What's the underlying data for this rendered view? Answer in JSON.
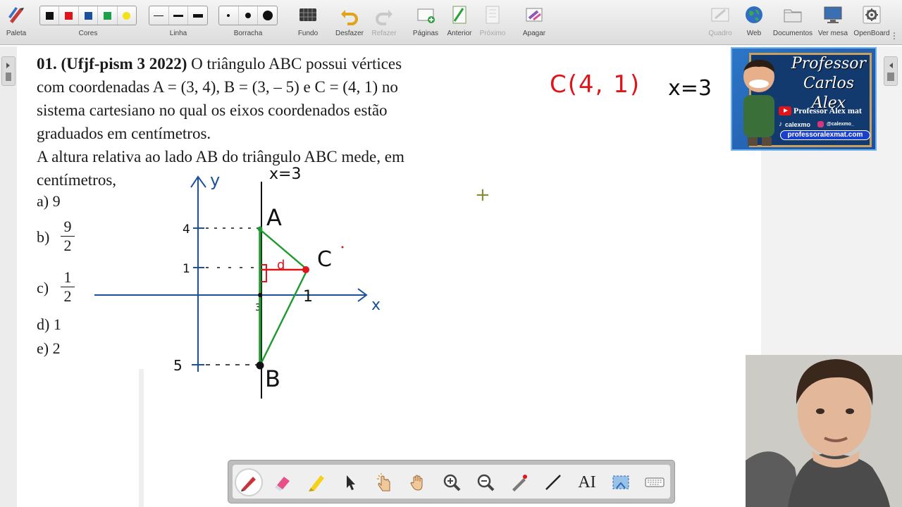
{
  "toolbar": {
    "groups": [
      {
        "label": "Paleta"
      },
      {
        "label": "Cores"
      },
      {
        "label": "Linha"
      },
      {
        "label": "Borracha"
      },
      {
        "label": "Fundo"
      },
      {
        "label": "Desfazer"
      },
      {
        "label": "Refazer"
      },
      {
        "label": "Páginas"
      },
      {
        "label": "Anterior"
      },
      {
        "label": "Próximo"
      },
      {
        "label": "Apagar"
      },
      {
        "label": "Quadro"
      },
      {
        "label": "Web"
      },
      {
        "label": "Documentos"
      },
      {
        "label": "Ver mesa"
      },
      {
        "label": "OpenBoard"
      }
    ],
    "colors": [
      "#111111",
      "#e0141b",
      "#1c4f9c",
      "#1aa14a",
      "#f2e21a"
    ]
  },
  "question": {
    "number": "01.",
    "source": "(Ufjf-pism 3 2022)",
    "line1_rest": " O triângulo ABC possui vértices",
    "line2": "com coordenadas A = (3, 4), B = (3, – 5) e C = (4, 1) no",
    "line3": "sistema cartesiano no qual os eixos coordenados estão",
    "line4": "graduados em centímetros.",
    "line5": "A altura relativa ao lado AB do triângulo ABC mede, em",
    "line6": "centímetros,"
  },
  "options": {
    "a_label": "a)",
    "a_value": "9",
    "b_label": "b)",
    "b_num": "9",
    "b_den": "2",
    "c_label": "c)",
    "c_num": "1",
    "c_den": "2",
    "d_label": "d)",
    "d_value": "1",
    "e_label": "e)",
    "e_value": "2"
  },
  "annotations": {
    "point_c": "C(4, 1)",
    "line_eq": "x=3",
    "graph_line_label": "x=3",
    "axis_y": "y",
    "axis_x": "x",
    "label_a": "A",
    "label_b": "B",
    "label_c": "C",
    "label_d": "d",
    "tick_4": "4",
    "tick_1": "1",
    "tick_5": "5",
    "tick_c1": "1",
    "tick_origin": "3"
  },
  "banner": {
    "title_line1": "Professor",
    "title_line2": "Carlos Alex",
    "youtube": "Professor Alex mat",
    "tiktok": "calexmo",
    "instagram": "@calexmo_",
    "site": "professoralexmat.com"
  },
  "bottom_tools": [
    "pen-tool",
    "eraser-tool",
    "highlighter-tool",
    "select-tool",
    "interact-tool",
    "hand-tool",
    "zoom-in-tool",
    "zoom-out-tool",
    "laser-tool",
    "line-tool",
    "text-tool",
    "capture-tool",
    "keyboard-tool"
  ],
  "text_tool_label": "AI",
  "chart_data": {
    "type": "scatter",
    "points": [
      {
        "name": "A",
        "x": 3,
        "y": 4
      },
      {
        "name": "B",
        "x": 3,
        "y": -5
      },
      {
        "name": "C",
        "x": 4,
        "y": 1
      }
    ],
    "xlabel": "x",
    "ylabel": "y"
  }
}
